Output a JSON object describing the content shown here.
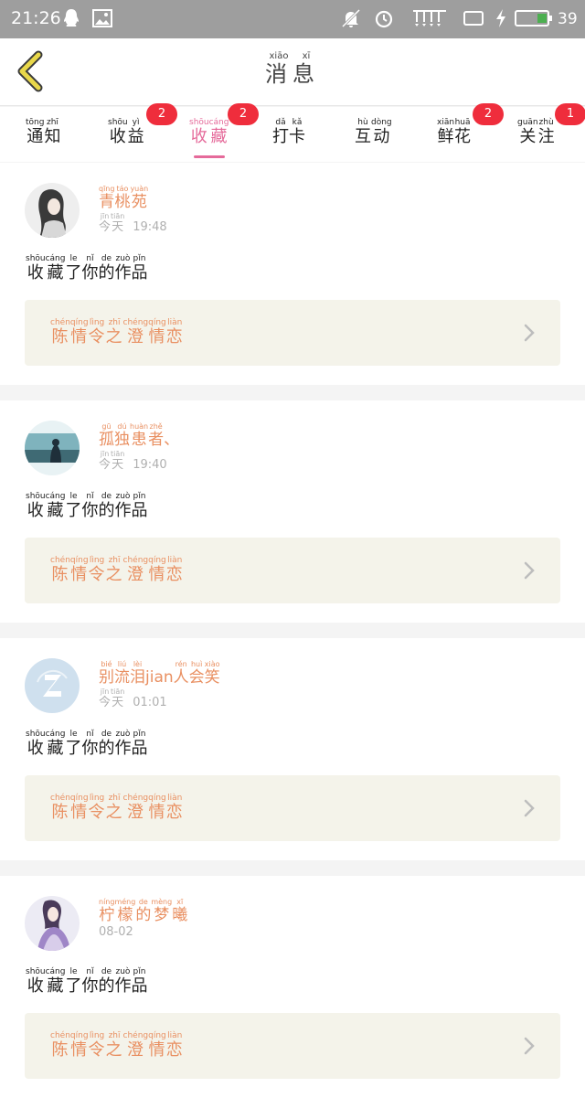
{
  "status_bar": {
    "time": "21:26",
    "battery_percent": "39",
    "icons": [
      "qq-icon",
      "image-icon",
      "mute-icon",
      "alarm-icon",
      "signal-icon",
      "tablet-icon",
      "charging-icon",
      "battery-icon"
    ]
  },
  "header": {
    "title": [
      {
        "char": "消",
        "py": "xiāo"
      },
      {
        "char": "息",
        "py": "xī"
      }
    ],
    "back_icon": "chevron-left-icon",
    "accent_color": "#e9d84a"
  },
  "tabs": [
    {
      "id": "notice",
      "chars": [
        {
          "char": "通",
          "py": "tōng"
        },
        {
          "char": "知",
          "py": "zhī"
        }
      ],
      "badge": ""
    },
    {
      "id": "income",
      "chars": [
        {
          "char": "收",
          "py": "shōu"
        },
        {
          "char": "益",
          "py": "yì"
        }
      ],
      "badge": "2"
    },
    {
      "id": "favorites",
      "chars": [
        {
          "char": "收",
          "py": "shōu"
        },
        {
          "char": "藏",
          "py": "cáng"
        }
      ],
      "badge": "2",
      "active": true
    },
    {
      "id": "checkin",
      "chars": [
        {
          "char": "打",
          "py": "dǎ"
        },
        {
          "char": "卡",
          "py": "kǎ"
        }
      ],
      "badge": ""
    },
    {
      "id": "interact",
      "chars": [
        {
          "char": "互",
          "py": "hù"
        },
        {
          "char": "动",
          "py": "dòng"
        }
      ],
      "badge": ""
    },
    {
      "id": "flowers",
      "chars": [
        {
          "char": "鲜",
          "py": "xiān"
        },
        {
          "char": "花",
          "py": "huā"
        }
      ],
      "badge": "2"
    },
    {
      "id": "follow",
      "chars": [
        {
          "char": "关",
          "py": "guān"
        },
        {
          "char": "注",
          "py": "zhù"
        }
      ],
      "badge": "1"
    }
  ],
  "colors": {
    "active_tab": "#e56a9a",
    "badge": "#ef2d3c",
    "username": "#e99062",
    "work_box_bg": "#f4f3ea"
  },
  "items": [
    {
      "username": [
        {
          "char": "青",
          "py": "qīng"
        },
        {
          "char": "桃",
          "py": "táo"
        },
        {
          "char": "苑",
          "py": "yuàn"
        }
      ],
      "date": [
        {
          "char": "今",
          "py": "jīn"
        },
        {
          "char": "天",
          "py": "tiān"
        }
      ],
      "time": "19:48",
      "avatar": "avatar-ink-girl",
      "action": [
        {
          "char": "收",
          "py": "shōu"
        },
        {
          "char": "藏",
          "py": "cáng"
        },
        {
          "char": "了",
          "py": "le"
        },
        {
          "char": "你",
          "py": "nǐ"
        },
        {
          "char": "的",
          "py": "de"
        },
        {
          "char": "作",
          "py": "zuò"
        },
        {
          "char": "品",
          "py": "pǐn"
        }
      ],
      "work": [
        {
          "char": "陈",
          "py": "chén"
        },
        {
          "char": "情",
          "py": "qíng"
        },
        {
          "char": "令",
          "py": "lìng"
        },
        {
          "char": "之",
          "py": "zhī"
        },
        {
          "char": "澄",
          "py": "chéng"
        },
        {
          "char": "情",
          "py": "qíng"
        },
        {
          "char": "恋",
          "py": "liàn"
        }
      ]
    },
    {
      "username": [
        {
          "char": "孤",
          "py": "gū"
        },
        {
          "char": "独",
          "py": "dú"
        },
        {
          "char": "患",
          "py": "huàn"
        },
        {
          "char": "者",
          "py": "zhě"
        },
        {
          "char": "、",
          "py": ""
        }
      ],
      "date": [
        {
          "char": "今",
          "py": "jīn"
        },
        {
          "char": "天",
          "py": "tiān"
        }
      ],
      "time": "19:40",
      "avatar": "avatar-scenery",
      "action": [
        {
          "char": "收",
          "py": "shōu"
        },
        {
          "char": "藏",
          "py": "cáng"
        },
        {
          "char": "了",
          "py": "le"
        },
        {
          "char": "你",
          "py": "nǐ"
        },
        {
          "char": "的",
          "py": "de"
        },
        {
          "char": "作",
          "py": "zuò"
        },
        {
          "char": "品",
          "py": "pǐn"
        }
      ],
      "work": [
        {
          "char": "陈",
          "py": "chén"
        },
        {
          "char": "情",
          "py": "qíng"
        },
        {
          "char": "令",
          "py": "lìng"
        },
        {
          "char": "之",
          "py": "zhī"
        },
        {
          "char": "澄",
          "py": "chéng"
        },
        {
          "char": "情",
          "py": "qíng"
        },
        {
          "char": "恋",
          "py": "liàn"
        }
      ]
    },
    {
      "username": [
        {
          "char": "别",
          "py": "bié"
        },
        {
          "char": "流",
          "py": "liú"
        },
        {
          "char": "泪",
          "py": "lèi"
        },
        {
          "char": "jian",
          "py": ""
        },
        {
          "char": "人",
          "py": "rén"
        },
        {
          "char": "会",
          "py": "huì"
        },
        {
          "char": "笑",
          "py": "xiào"
        }
      ],
      "date": [
        {
          "char": "今",
          "py": "jīn"
        },
        {
          "char": "天",
          "py": "tiān"
        }
      ],
      "time": "01:01",
      "avatar": "avatar-qq-default",
      "action": [
        {
          "char": "收",
          "py": "shōu"
        },
        {
          "char": "藏",
          "py": "cáng"
        },
        {
          "char": "了",
          "py": "le"
        },
        {
          "char": "你",
          "py": "nǐ"
        },
        {
          "char": "的",
          "py": "de"
        },
        {
          "char": "作",
          "py": "zuò"
        },
        {
          "char": "品",
          "py": "pǐn"
        }
      ],
      "work": [
        {
          "char": "陈",
          "py": "chén"
        },
        {
          "char": "情",
          "py": "qíng"
        },
        {
          "char": "令",
          "py": "lìng"
        },
        {
          "char": "之",
          "py": "zhī"
        },
        {
          "char": "澄",
          "py": "chéng"
        },
        {
          "char": "情",
          "py": "qíng"
        },
        {
          "char": "恋",
          "py": "liàn"
        }
      ]
    },
    {
      "username": [
        {
          "char": "柠",
          "py": "níng"
        },
        {
          "char": "檬",
          "py": "méng"
        },
        {
          "char": "的",
          "py": "de"
        },
        {
          "char": "梦",
          "py": "mèng"
        },
        {
          "char": "曦",
          "py": "xī"
        }
      ],
      "date": [],
      "time": "08-02",
      "avatar": "avatar-purple-girl",
      "action": [
        {
          "char": "收",
          "py": "shōu"
        },
        {
          "char": "藏",
          "py": "cáng"
        },
        {
          "char": "了",
          "py": "le"
        },
        {
          "char": "你",
          "py": "nǐ"
        },
        {
          "char": "的",
          "py": "de"
        },
        {
          "char": "作",
          "py": "zuò"
        },
        {
          "char": "品",
          "py": "pǐn"
        }
      ],
      "work": [
        {
          "char": "陈",
          "py": "chén"
        },
        {
          "char": "情",
          "py": "qíng"
        },
        {
          "char": "令",
          "py": "lìng"
        },
        {
          "char": "之",
          "py": "zhī"
        },
        {
          "char": "澄",
          "py": "chéng"
        },
        {
          "char": "情",
          "py": "qíng"
        },
        {
          "char": "恋",
          "py": "liàn"
        }
      ]
    }
  ]
}
